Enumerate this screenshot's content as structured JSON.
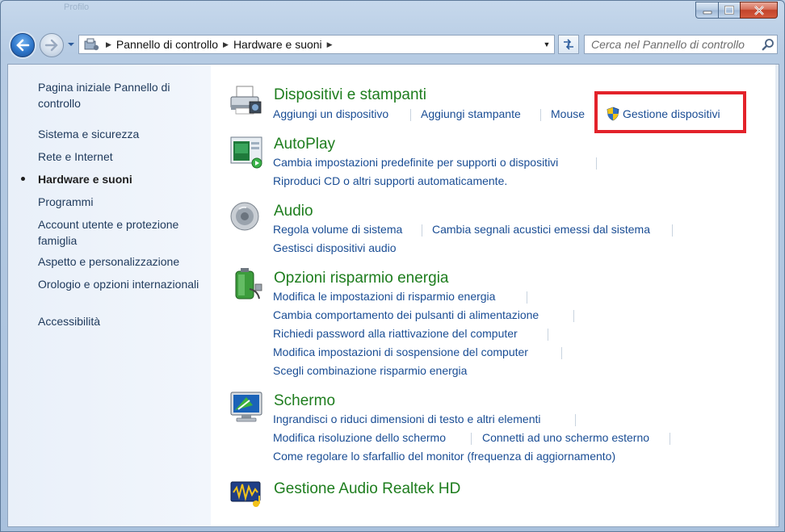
{
  "window": {
    "background_title": "Profilo"
  },
  "nav": {
    "breadcrumb": [
      "Pannello di controllo",
      "Hardware e suoni"
    ],
    "search_placeholder": "Cerca nel Pannello di controllo"
  },
  "sidebar": {
    "home": "Pagina iniziale Pannello di controllo",
    "items": [
      "Sistema e sicurezza",
      "Rete e Internet",
      "Hardware e suoni",
      "Programmi",
      "Account utente e protezione famiglia",
      "Aspetto e personalizzazione",
      "Orologio e opzioni internazionali",
      "Accessibilità"
    ],
    "active_index": 2
  },
  "categories": [
    {
      "title": "Dispositivi e stampanti",
      "icon": "printer-icon",
      "links": [
        "Aggiungi un dispositivo",
        "Aggiungi stampante",
        "Mouse",
        "Gestione dispositivi"
      ]
    },
    {
      "title": "AutoPlay",
      "icon": "autoplay-icon",
      "links": [
        "Cambia impostazioni predefinite per supporti o dispositivi",
        "Riproduci CD o altri supporti automaticamente."
      ]
    },
    {
      "title": "Audio",
      "icon": "speaker-icon",
      "links": [
        "Regola volume di sistema",
        "Cambia segnali acustici emessi dal sistema",
        "Gestisci dispositivi audio"
      ]
    },
    {
      "title": "Opzioni risparmio energia",
      "icon": "battery-icon",
      "links": [
        "Modifica le impostazioni di risparmio energia",
        "Cambia comportamento dei pulsanti di alimentazione",
        "Richiedi password alla riattivazione del computer",
        "Modifica impostazioni di sospensione del computer",
        "Scegli combinazione risparmio energia"
      ]
    },
    {
      "title": "Schermo",
      "icon": "monitor-icon",
      "links": [
        "Ingrandisci o riduci dimensioni di testo e altri elementi",
        "Modifica risoluzione dello schermo",
        "Connetti ad uno schermo esterno",
        "Come regolare lo sfarfallio del monitor (frequenza di aggiornamento)"
      ]
    },
    {
      "title": "Gestione Audio Realtek HD",
      "icon": "realtek-audio-icon",
      "links": []
    }
  ],
  "colors": {
    "title_green": "#1e7d1e",
    "link_blue": "#1a4d94",
    "highlight_red": "#e3222a"
  }
}
